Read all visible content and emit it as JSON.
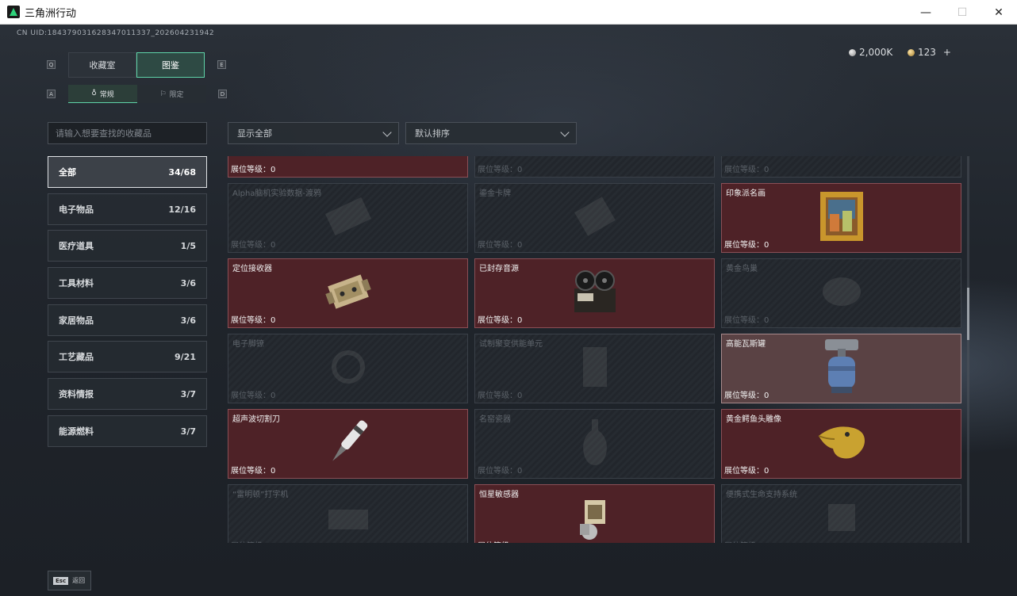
{
  "window": {
    "title": "三角洲行动",
    "controls": {
      "minimize": "—",
      "maximize": "☐",
      "close": "✕"
    }
  },
  "header": {
    "uid": "CN UID:18437903162834701133​7_20260423194​2",
    "currency_silver": "2,000K",
    "currency_gold": "123",
    "add_label": "+"
  },
  "tabs": {
    "main": [
      {
        "label": "收藏室",
        "active": false,
        "key_left": "Q"
      },
      {
        "label": "图鉴",
        "active": true,
        "key_right": "E"
      }
    ],
    "sub": [
      {
        "label": "常规",
        "active": true,
        "key_left": "A"
      },
      {
        "label": "限定",
        "active": false,
        "key_right": "D"
      }
    ]
  },
  "search": {
    "placeholder": "请输入想要查找的收藏品",
    "value": ""
  },
  "filters": {
    "display": "显示全部",
    "sort": "默认排序"
  },
  "categories": [
    {
      "label": "全部",
      "count": "34/68",
      "active": true
    },
    {
      "label": "电子物品",
      "count": "12/16"
    },
    {
      "label": "医疗道具",
      "count": "1/5"
    },
    {
      "label": "工具材料",
      "count": "3/6"
    },
    {
      "label": "家居物品",
      "count": "3/6"
    },
    {
      "label": "工艺藏品",
      "count": "9/21"
    },
    {
      "label": "资料情报",
      "count": "3/7"
    },
    {
      "label": "能源燃料",
      "count": "3/7"
    }
  ],
  "level_label": "展位等级：0",
  "items": [
    {
      "name": "",
      "owned": true,
      "icon": "gold-cylinder-icon"
    },
    {
      "name": "",
      "owned": false,
      "icon": "device-icon"
    },
    {
      "name": "",
      "owned": false,
      "icon": "box-icon"
    },
    {
      "name": "Alpha脑机实验数据-渡鸦",
      "owned": false,
      "icon": "chip-icon"
    },
    {
      "name": "鎏金卡牌",
      "owned": false,
      "icon": "card-icon"
    },
    {
      "name": "印象派名画",
      "owned": true,
      "icon": "painting-icon"
    },
    {
      "name": "定位接收器",
      "owned": true,
      "icon": "receiver-icon"
    },
    {
      "name": "已封存音源",
      "owned": true,
      "icon": "tape-recorder-icon"
    },
    {
      "name": "黄金鸟巢",
      "owned": false,
      "icon": "nest-icon"
    },
    {
      "name": "电子脚镣",
      "owned": false,
      "icon": "shackle-icon"
    },
    {
      "name": "试制聚变供能单元",
      "owned": false,
      "icon": "fusion-unit-icon"
    },
    {
      "name": "高能瓦斯罐",
      "owned": true,
      "highlight": true,
      "icon": "gas-canister-icon"
    },
    {
      "name": "超声波切割刀",
      "owned": true,
      "icon": "ultrasonic-knife-icon"
    },
    {
      "name": "名窑瓷器",
      "owned": false,
      "icon": "vase-icon"
    },
    {
      "name": "黄金鳄鱼头雕像",
      "owned": true,
      "icon": "gold-croc-icon"
    },
    {
      "name": "“雷明顿”打字机",
      "owned": false,
      "icon": "typewriter-icon"
    },
    {
      "name": "恒星敏感器",
      "owned": true,
      "icon": "star-sensor-icon"
    },
    {
      "name": "便携式生命支持系统",
      "owned": false,
      "icon": "life-support-icon"
    }
  ],
  "bottom": {
    "esc_key": "Esc",
    "esc_label": "返回"
  },
  "colors": {
    "accent": "#5fd4a8",
    "owned_card": "#4e2227",
    "highlight_card": "#5a4244",
    "locked_card": "#262b31"
  }
}
